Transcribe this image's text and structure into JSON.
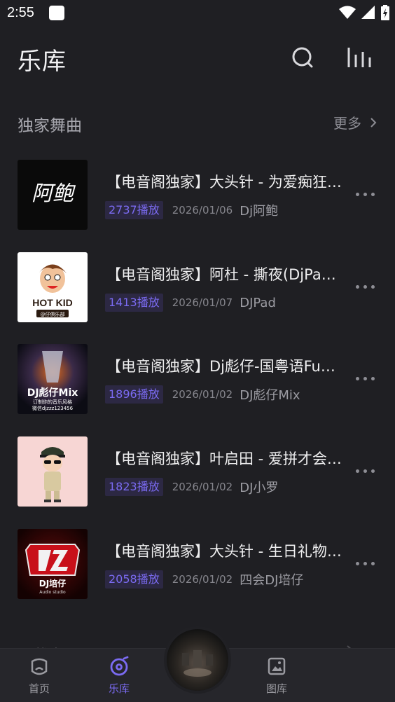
{
  "status_bar": {
    "time": "2:55"
  },
  "header": {
    "title": "乐库"
  },
  "section": {
    "title": "独家舞曲",
    "more_label": "更多"
  },
  "tracks": [
    {
      "title": "【电音阁独家】大头针 - 为爱痴狂…",
      "plays": "2737播放",
      "date": "2026/01/06",
      "artist": "Dj阿鲍",
      "cover_text": "阿鲍"
    },
    {
      "title": "【电音阁独家】阿杜 - 撕夜(DjPad…",
      "plays": "1413播放",
      "date": "2026/01/07",
      "artist": "DJPad",
      "cover_text": "HOT KID",
      "cover_sub": "@仔俱乐部"
    },
    {
      "title": "【电音阁独家】Dj彪仔-国粤语Fun…",
      "plays": "1896播放",
      "date": "2026/01/02",
      "artist": "DJ彪仔Mix",
      "cover_text": "DJ彪仔Mix",
      "cover_sub": "订制你的音乐风格",
      "cover_sub2": "微信djzzz123456"
    },
    {
      "title": "【电音阁独家】叶启田 - 爱拼才会…",
      "plays": "1823播放",
      "date": "2026/01/02",
      "artist": "DJ小罗"
    },
    {
      "title": "【电音阁独家】大头针 - 生日礼物…",
      "plays": "2058播放",
      "date": "2026/01/02",
      "artist": "四会DJ培仔",
      "cover_text": "DJ培仔",
      "cover_sub": "Audio studio"
    }
  ],
  "next_section": {
    "title": "下载中心"
  },
  "bottom_nav": {
    "items": [
      {
        "label": "首页"
      },
      {
        "label": "乐库"
      },
      {
        "label": "图库"
      }
    ]
  },
  "colors": {
    "background": "#1f1f23",
    "accent": "#7b6bf2",
    "badge_bg": "#2c2843",
    "nav_bg": "#26262b"
  }
}
